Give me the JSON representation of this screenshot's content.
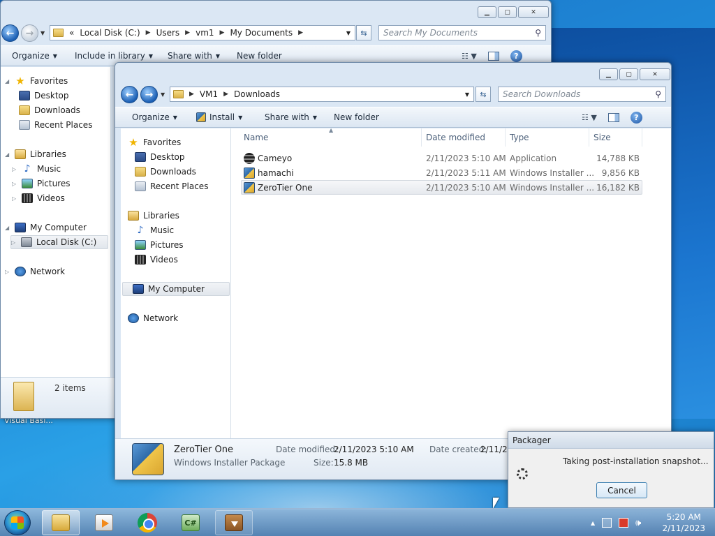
{
  "desktop": {
    "partial_label": "Visual Basi..."
  },
  "back_window": {
    "address": {
      "crumbs": [
        "Local Disk (C:)",
        "Users",
        "vm1",
        "My Documents"
      ],
      "overflow": "«"
    },
    "search_placeholder": "Search My Documents",
    "toolbar": {
      "organize": "Organize",
      "include_library": "Include in library",
      "share_with": "Share with",
      "new_folder": "New folder"
    },
    "nav": {
      "favorites": "Favorites",
      "desktop": "Desktop",
      "downloads": "Downloads",
      "recent_places": "Recent Places",
      "libraries": "Libraries",
      "music": "Music",
      "pictures": "Pictures",
      "videos": "Videos",
      "my_computer": "My Computer",
      "local_disk": "Local Disk (C:)",
      "network": "Network"
    },
    "details": {
      "item_count": "2 items"
    }
  },
  "front_window": {
    "address": {
      "crumbs": [
        "VM1",
        "Downloads"
      ]
    },
    "search_placeholder": "Search Downloads",
    "toolbar": {
      "organize": "Organize",
      "install": "Install",
      "share_with": "Share with",
      "new_folder": "New folder"
    },
    "nav": {
      "favorites": "Favorites",
      "desktop": "Desktop",
      "downloads": "Downloads",
      "recent_places": "Recent Places",
      "libraries": "Libraries",
      "music": "Music",
      "pictures": "Pictures",
      "videos": "Videos",
      "my_computer": "My Computer",
      "network": "Network"
    },
    "columns": {
      "name": "Name",
      "date_modified": "Date modified",
      "type": "Type",
      "size": "Size"
    },
    "files": [
      {
        "name": "Cameyo",
        "date": "2/11/2023 5:10 AM",
        "type": "Application",
        "size": "14,788 KB",
        "icon": "cameyo-icon"
      },
      {
        "name": "hamachi",
        "date": "2/11/2023 5:11 AM",
        "type": "Windows Installer ...",
        "size": "9,856 KB",
        "icon": "msi-icon"
      },
      {
        "name": "ZeroTier One",
        "date": "2/11/2023 5:10 AM",
        "type": "Windows Installer ...",
        "size": "16,182 KB",
        "icon": "msi-icon"
      }
    ],
    "details": {
      "name": "ZeroTier One",
      "type": "Windows Installer Package",
      "date_modified_label": "Date modified:",
      "date_modified": "2/11/2023 5:10 AM",
      "size_label": "Size:",
      "size": "15.8 MB",
      "date_created_label": "Date created:",
      "date_created": "2/11/20"
    }
  },
  "dialog": {
    "title": "Packager",
    "message": "Taking post-installation snapshot...",
    "cancel": "Cancel"
  },
  "taskbar": {
    "apps": [
      "windows-explorer",
      "media-player",
      "chrome",
      "csharp-editor",
      "packager"
    ],
    "clock": {
      "time": "5:20 AM",
      "date": "2/11/2023"
    },
    "csharp_label": "C#"
  }
}
